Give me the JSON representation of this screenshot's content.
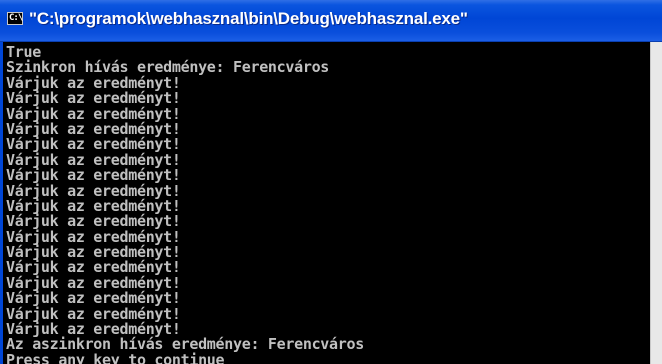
{
  "window": {
    "title": "\"C:\\programok\\webhasznal\\bin\\Debug\\webhasznal.exe\"",
    "icon_name": "console-window-icon",
    "icon_glyph": "C:\\"
  },
  "console": {
    "lines": [
      "True",
      "Szinkron hívás eredménye: Ferencváros",
      "Várjuk az eredményt!",
      "Várjuk az eredményt!",
      "Várjuk az eredményt!",
      "Várjuk az eredményt!",
      "Várjuk az eredményt!",
      "Várjuk az eredményt!",
      "Várjuk az eredményt!",
      "Várjuk az eredményt!",
      "Várjuk az eredményt!",
      "Várjuk az eredményt!",
      "Várjuk az eredményt!",
      "Várjuk az eredményt!",
      "Várjuk az eredményt!",
      "Várjuk az eredményt!",
      "Várjuk az eredményt!",
      "Várjuk az eredményt!",
      "Várjuk az eredményt!",
      "Az aszinkron hívás eredménye: Ferencváros",
      "Press any key to continue"
    ]
  },
  "colors": {
    "titlebar": "#0046d6",
    "console_background": "#000000",
    "console_text": "#c0c0c0"
  }
}
